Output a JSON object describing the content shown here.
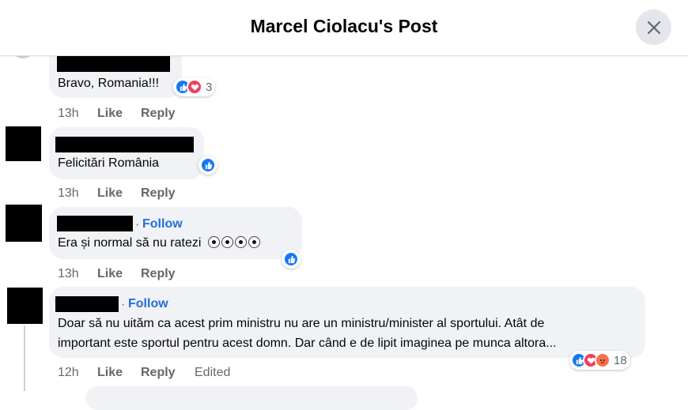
{
  "header": {
    "title": "Marcel Ciolacu's Post"
  },
  "comments": [
    {
      "text": "Bravo, Romania!!!",
      "reactions": {
        "types": [
          "like",
          "love"
        ],
        "count": "3"
      },
      "actions": {
        "time": "13h",
        "like": "Like",
        "reply": "Reply"
      }
    },
    {
      "text": "Felicitări România",
      "reactions": {
        "types": [
          "like"
        ]
      },
      "actions": {
        "time": "13h",
        "like": "Like",
        "reply": "Reply"
      }
    },
    {
      "follow": "Follow",
      "separator": "·",
      "text": "Era și normal să nu ratezi",
      "reactions": {
        "types": [
          "like"
        ]
      },
      "actions": {
        "time": "13h",
        "like": "Like",
        "reply": "Reply"
      }
    },
    {
      "follow": "Follow",
      "separator": "·",
      "text_line1": "Doar să nu uităm ca acest prim ministru nu are un ministru/minister al sportului. Atât de",
      "text_line2": "important este sportul pentru acest domn. Dar când e de lipit imaginea pe munca altora...",
      "reactions": {
        "types": [
          "like",
          "love",
          "angry"
        ],
        "count": "18"
      },
      "actions": {
        "time": "12h",
        "like": "Like",
        "reply": "Reply",
        "edited": "Edited"
      }
    }
  ]
}
